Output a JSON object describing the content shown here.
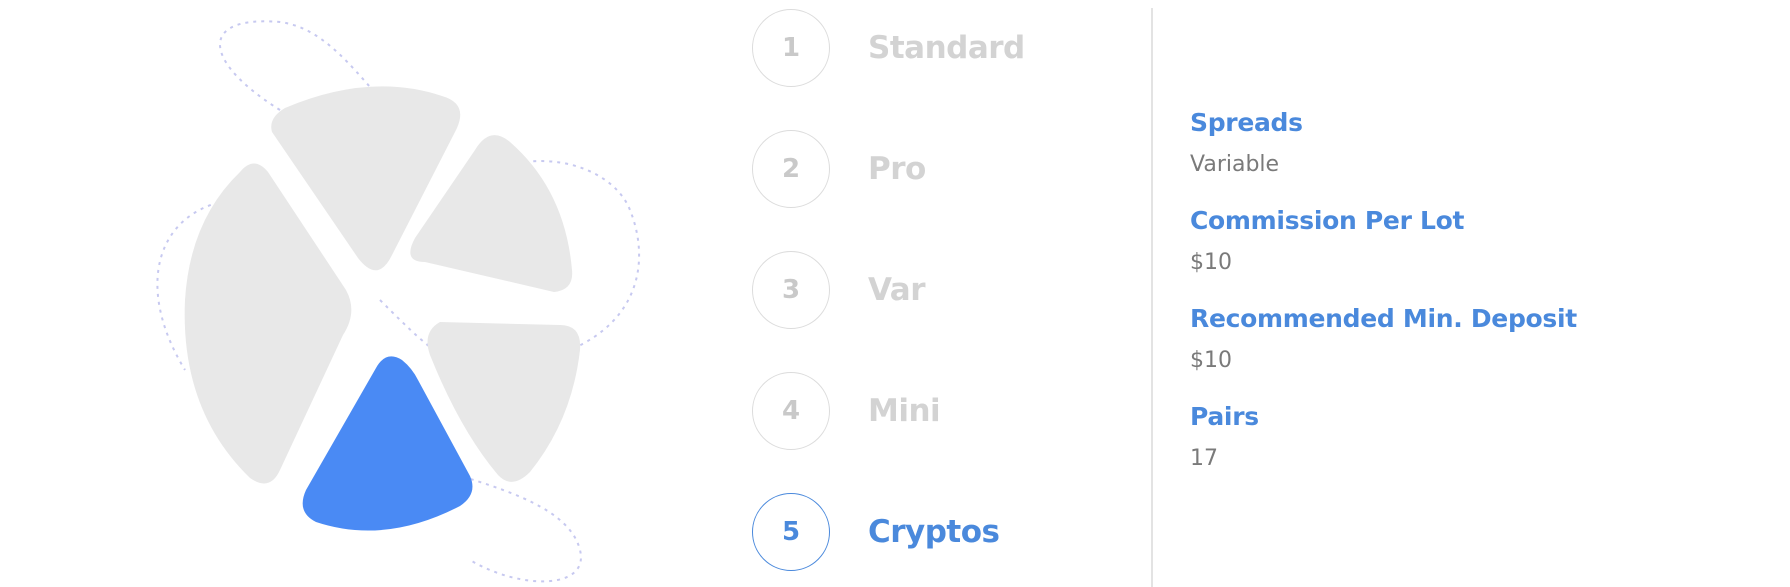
{
  "colors": {
    "accent": "#4a89dc",
    "inactive_text": "#d3d3d3",
    "petal_gray": "#e8e8e8",
    "petal_active": "#4a8af4",
    "dashed_outline": "#c7c9f0"
  },
  "account_types": {
    "selected_index": 4,
    "items": [
      {
        "number": "1",
        "label": "Standard"
      },
      {
        "number": "2",
        "label": "Pro"
      },
      {
        "number": "3",
        "label": "Var"
      },
      {
        "number": "4",
        "label": "Mini"
      },
      {
        "number": "5",
        "label": "Cryptos"
      }
    ]
  },
  "details": [
    {
      "title": "Spreads",
      "value": "Variable"
    },
    {
      "title": "Commission Per Lot",
      "value": "$10"
    },
    {
      "title": "Recommended Min. Deposit",
      "value": "$10"
    },
    {
      "title": "Pairs",
      "value": "17"
    }
  ]
}
